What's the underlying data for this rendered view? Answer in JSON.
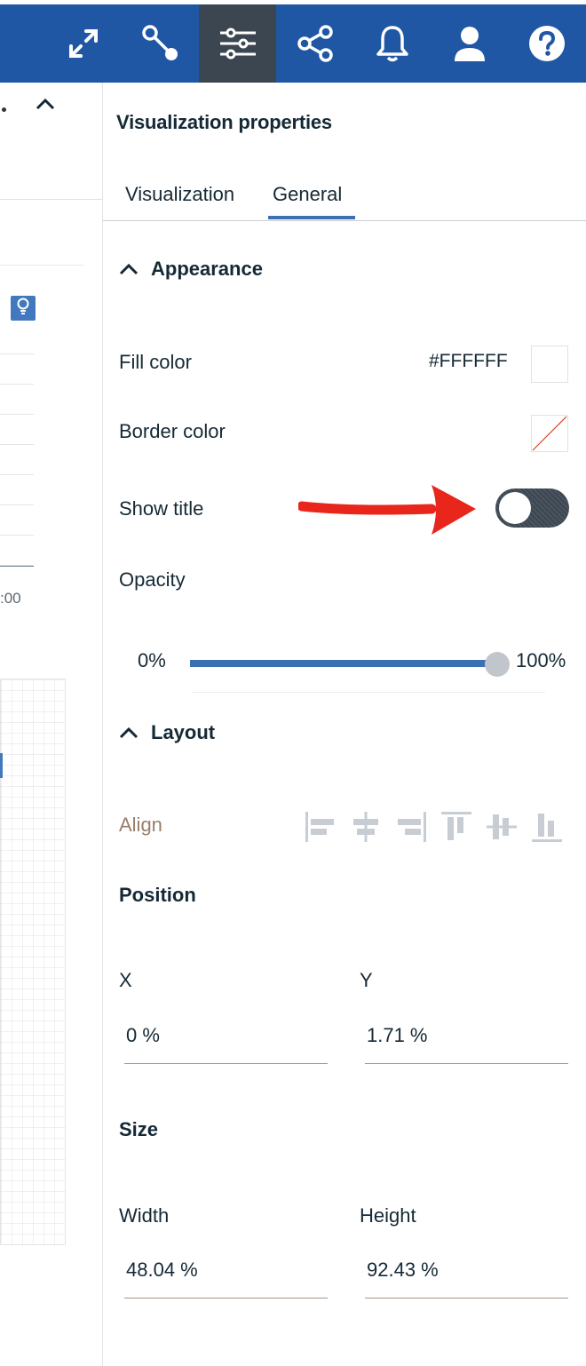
{
  "toolbar": {
    "items": [
      {
        "icon": "expand-icon"
      },
      {
        "icon": "connection-icon"
      },
      {
        "icon": "properties-sliders-icon",
        "active": true
      },
      {
        "icon": "share-icon"
      },
      {
        "icon": "bell-icon"
      },
      {
        "icon": "user-icon"
      },
      {
        "icon": "help-icon"
      }
    ],
    "background_color": "#1f57a4",
    "active_color": "#3b4650"
  },
  "canvas": {
    "time_label": ":00"
  },
  "panel": {
    "title": "Visualization properties",
    "tabs": [
      {
        "label": "Visualization",
        "selected": false
      },
      {
        "label": "General",
        "selected": true
      }
    ],
    "appearance": {
      "heading": "Appearance",
      "fill_color_label": "Fill color",
      "fill_color_value": "#FFFFFF",
      "border_color_label": "Border color",
      "border_color_value": "none",
      "show_title_label": "Show title",
      "show_title_on": false,
      "opacity_label": "Opacity",
      "opacity_min": "0%",
      "opacity_max": "100%",
      "opacity_value": 1.0
    },
    "layout": {
      "heading": "Layout",
      "align_label": "Align",
      "align_icons": [
        "align-left-icon",
        "align-center-horizontal-icon",
        "align-right-icon",
        "align-top-icon",
        "align-middle-vertical-icon",
        "align-bottom-icon"
      ],
      "position_heading": "Position",
      "x_label": "X",
      "x_value": "0 %",
      "y_label": "Y",
      "y_value": "1.71 %",
      "size_heading": "Size",
      "width_label": "Width",
      "width_value": "48.04 %",
      "height_label": "Height",
      "height_value": "92.43 %"
    }
  },
  "annotation": {
    "color": "#e8261b",
    "icon": "red-arrow-annotation"
  }
}
